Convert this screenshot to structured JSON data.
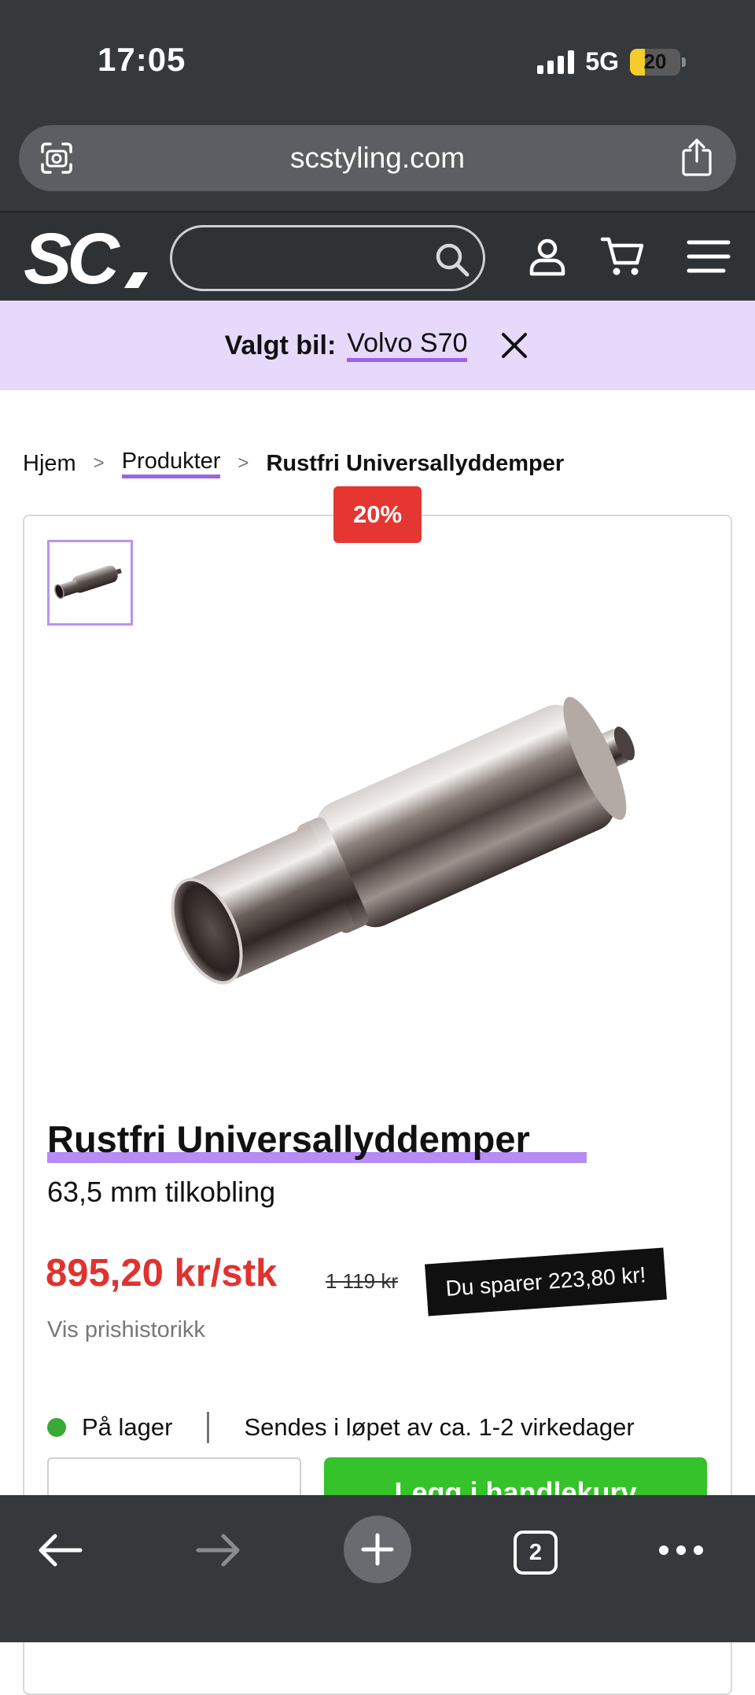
{
  "status_bar": {
    "time": "17:05",
    "network": "5G",
    "battery": "20"
  },
  "browser": {
    "url": "scstyling.com",
    "tab_count": "2"
  },
  "header": {
    "logo_text": "SC",
    "search_placeholder": ""
  },
  "car_banner": {
    "label": "Valgt bil:",
    "car": "Volvo S70"
  },
  "breadcrumb": {
    "home": "Hjem",
    "separator": ">",
    "products": "Produkter",
    "current": "Rustfri Universallyddemper"
  },
  "product": {
    "discount": "20%",
    "title": "Rustfri Universallyddemper",
    "subtitle": "63,5 mm tilkobling",
    "price": "895,20 kr/stk",
    "old_price": "1 119 kr",
    "savings": "Du sparer 223,80 kr!",
    "price_history": "Vis prishistorikk",
    "stock_status": "På lager",
    "shipping": "Sendes i løpet av ca. 1-2 virkedager",
    "cart_button": "Legg i handlekurv"
  },
  "colors": {
    "accent_purple": "#9a64ea",
    "banner_bg": "#e6d9fb",
    "price_red": "#e0322f",
    "discount_red": "#e53632",
    "cart_green": "#36c22a",
    "header_dark": "#2f3234"
  }
}
